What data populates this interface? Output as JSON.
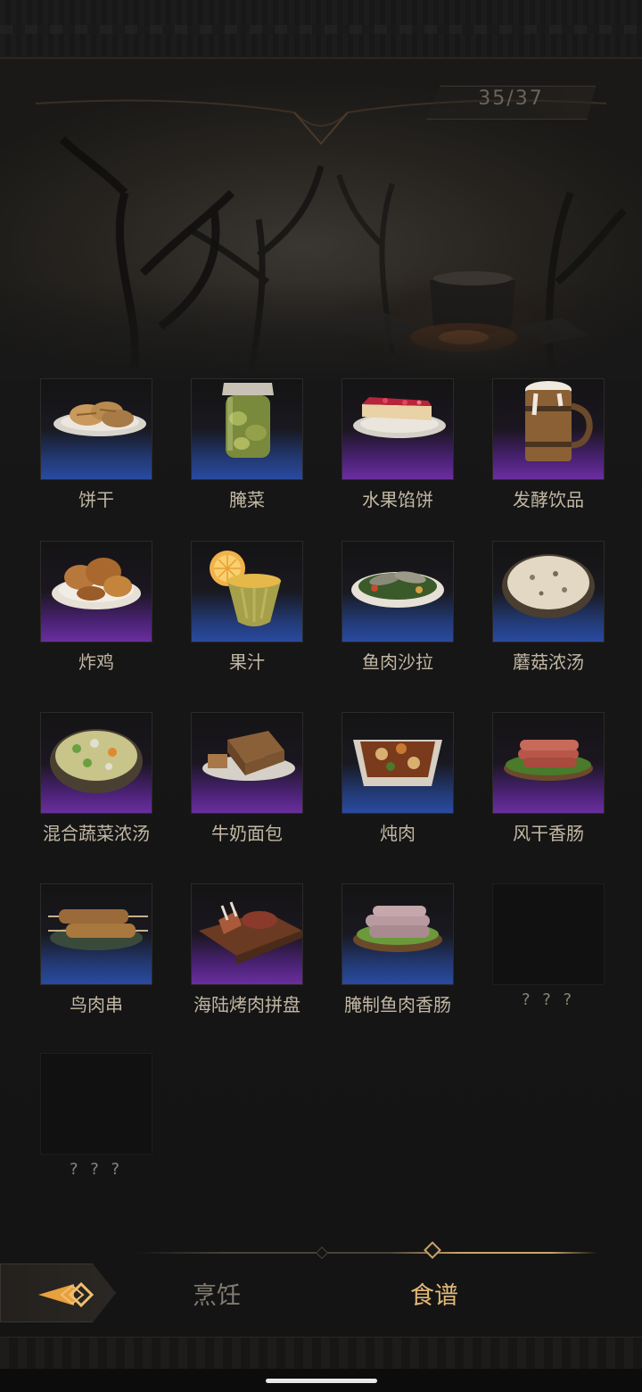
{
  "header": {
    "counter": "35/37"
  },
  "recipes": [
    {
      "name": "饼干",
      "rarity": "blue",
      "icon": "biscuit-plate"
    },
    {
      "name": "腌菜",
      "rarity": "blue",
      "icon": "pickle-jar"
    },
    {
      "name": "水果馅饼",
      "rarity": "purple",
      "icon": "fruit-pie-slice"
    },
    {
      "name": "发酵饮品",
      "rarity": "purple",
      "icon": "ale-tankard"
    },
    {
      "name": "炸鸡",
      "rarity": "purple",
      "icon": "fried-chicken-plate"
    },
    {
      "name": "果汁",
      "rarity": "blue",
      "icon": "juice-cup"
    },
    {
      "name": "鱼肉沙拉",
      "rarity": "blue",
      "icon": "fish-salad-bowl"
    },
    {
      "name": "蘑菇浓汤",
      "rarity": "blue",
      "icon": "mushroom-soup-bowl"
    },
    {
      "name": "混合蔬菜浓汤",
      "rarity": "purple",
      "icon": "vegetable-soup-bowl"
    },
    {
      "name": "牛奶面包",
      "rarity": "purple",
      "icon": "milk-bread"
    },
    {
      "name": "炖肉",
      "rarity": "blue",
      "icon": "stew-dish"
    },
    {
      "name": "风干香肠",
      "rarity": "purple",
      "icon": "dried-sausage-plate"
    },
    {
      "name": "鸟肉串",
      "rarity": "blue",
      "icon": "bird-skewers"
    },
    {
      "name": "海陆烤肉拼盘",
      "rarity": "purple",
      "icon": "grill-platter"
    },
    {
      "name": "腌制鱼肉香肠",
      "rarity": "blue",
      "icon": "fish-sausage-plate"
    },
    {
      "name": "? ? ?",
      "rarity": "locked",
      "icon": "locked-slot"
    },
    {
      "name": "? ? ?",
      "rarity": "locked",
      "icon": "locked-slot"
    }
  ],
  "tabs": {
    "cook": "烹饪",
    "recipes": "食谱",
    "active": "recipes"
  },
  "colors": {
    "blue_rarity": "#2a4aa0",
    "purple_rarity": "#6a2e9e",
    "active_tab": "#e2b878",
    "inactive_tab": "#837c70"
  }
}
